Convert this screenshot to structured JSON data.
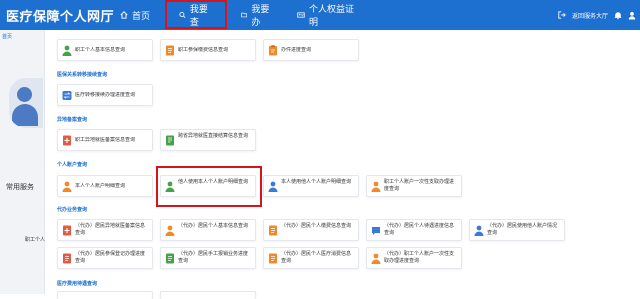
{
  "header": {
    "title": "医疗保障个人网厅",
    "nav": [
      {
        "label": "首页",
        "icon": "home-icon"
      },
      {
        "label": "我要查",
        "icon": "search-icon"
      },
      {
        "label": "我要办",
        "icon": "folder-icon"
      },
      {
        "label": "个人权益证明",
        "icon": "id-card-icon"
      }
    ],
    "back_label": "返回服务大厅"
  },
  "sidebar": {
    "tag": "首页",
    "service_title": "常用服务",
    "user_text": "职工个人"
  },
  "sections": {
    "s0": {
      "cards": [
        "职工个人基本信息查询",
        "职工参保缴费信息查询",
        "办件进度查询"
      ]
    },
    "s1": {
      "title": "医保关系转移接续查询",
      "cards": [
        "医疗转移接续办理进度查询"
      ]
    },
    "s2": {
      "title": "异地备案查询",
      "cards": [
        "职工异地就医备案信息查询",
        "跨省异地就医直接结算信息查询"
      ]
    },
    "s3": {
      "title": "个人账户查询",
      "cards": [
        "本人个人账户明细查询",
        "他人使用本人个人账户明细查询",
        "本人使用他人个人账户明细查询",
        "职工个人账户一次性支取办理进度查询"
      ]
    },
    "s4": {
      "title": "代办业务查询",
      "cards": [
        "（代办）居民异地就医备案信息查询",
        "（代办）居民个人基本信息查询",
        "（代办）居民个人缴费信息查询",
        "（代办）居民个人待遇进度信息查询",
        "（代办）居民使用他人账户情况查询",
        "（代办）居民参保登记办理进度查询",
        "（代办）居民手工报销业务进度查询",
        "（代办）居民个人医疗消费信息查询",
        "（代办）职工个人账户一次性支取办理进度查询"
      ]
    },
    "s5": {
      "title": "医疗费用待遇查询"
    }
  },
  "colors": {
    "primary": "#1d6fd0",
    "highlight": "#d8141b",
    "icon_green": "#45a24b",
    "icon_orange": "#ef8a2b",
    "icon_blue": "#3a7bd5",
    "icon_red": "#e25b45"
  }
}
